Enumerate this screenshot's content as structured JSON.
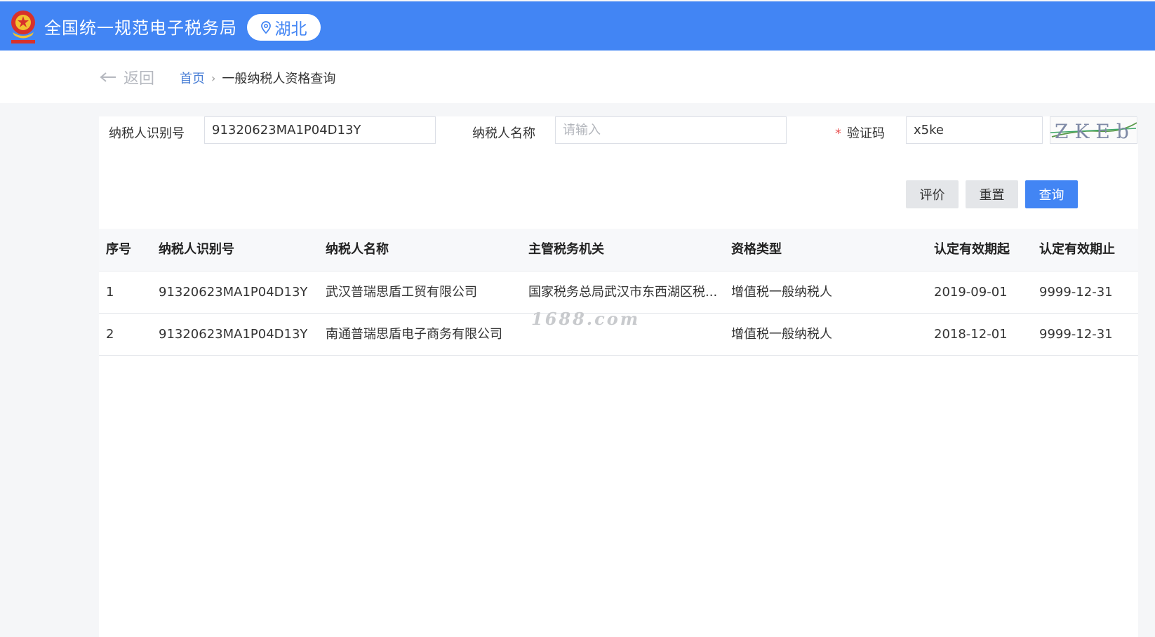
{
  "header": {
    "title": "全国统一规范电子税务局",
    "region": "湖北",
    "brand_color": "#4285f4"
  },
  "nav": {
    "back_label": "返回",
    "breadcrumb": {
      "home": "首页",
      "separator": "›",
      "current": "一般纳税人资格查询"
    }
  },
  "form": {
    "taxpayer_id_label": "纳税人识别号",
    "taxpayer_id_value": "91320623MA1P04D13Y",
    "taxpayer_name_label": "纳税人名称",
    "taxpayer_name_placeholder": "请输入",
    "required_mark": "*",
    "captcha_label": "验证码",
    "captcha_value": "x5ke",
    "captcha_image_text": "ZKEb"
  },
  "buttons": {
    "evaluate": "评价",
    "reset": "重置",
    "query": "查询"
  },
  "table": {
    "headers": [
      "序号",
      "纳税人识别号",
      "纳税人名称",
      "主管税务机关",
      "资格类型",
      "认定有效期起",
      "认定有效期止"
    ],
    "rows": [
      [
        "1",
        "91320623MA1P04D13Y",
        "武汉普瑞思盾工贸有限公司",
        "国家税务总局武汉市东西湖区税...",
        "增值税一般纳税人",
        "2019-09-01",
        "9999-12-31"
      ],
      [
        "2",
        "91320623MA1P04D13Y",
        "南通普瑞思盾电子商务有限公司",
        "",
        "增值税一般纳税人",
        "2018-12-01",
        "9999-12-31"
      ]
    ]
  },
  "watermark": "1688.com"
}
